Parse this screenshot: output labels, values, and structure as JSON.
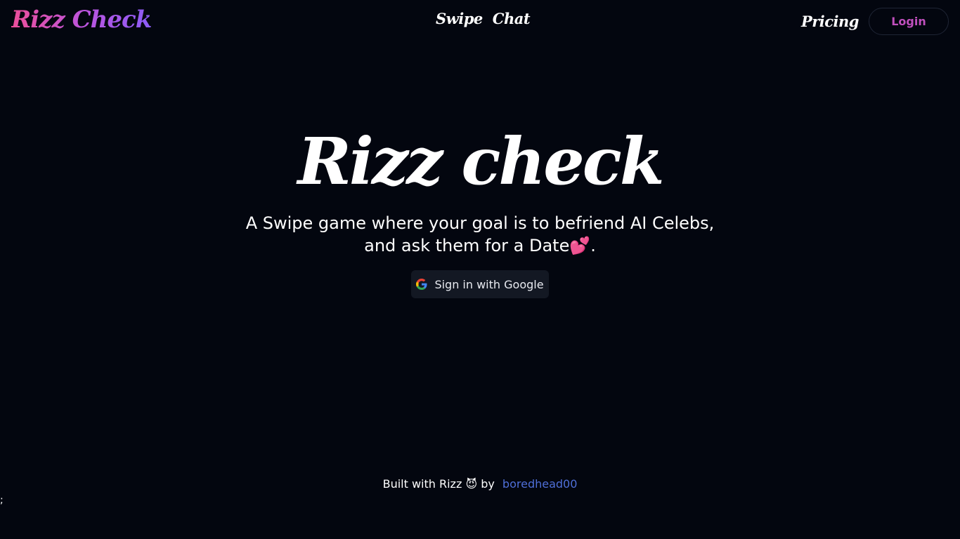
{
  "header": {
    "brand": "Rizz Check",
    "nav": [
      "Swipe",
      "Chat"
    ],
    "pricing_label": "Pricing",
    "login_label": "Login"
  },
  "hero": {
    "title": "Rizz check",
    "subtitle_line1": "A Swipe game where your goal is to befriend AI Celebs,",
    "subtitle_line2": "and ask them for a Date💕.",
    "google_button_label": "Sign in with Google"
  },
  "footer": {
    "prefix": "Built with Rizz 😈 by",
    "author_link": "boredhead00"
  },
  "stray_text": ";",
  "colors": {
    "background": "#03060f",
    "brand_gradient_start": "#ec4f9a",
    "brand_gradient_end": "#8b5cf6",
    "login_text": "#c04fbd",
    "link": "#4f6fd8"
  },
  "icons": {
    "google_button": "google-g-icon"
  }
}
